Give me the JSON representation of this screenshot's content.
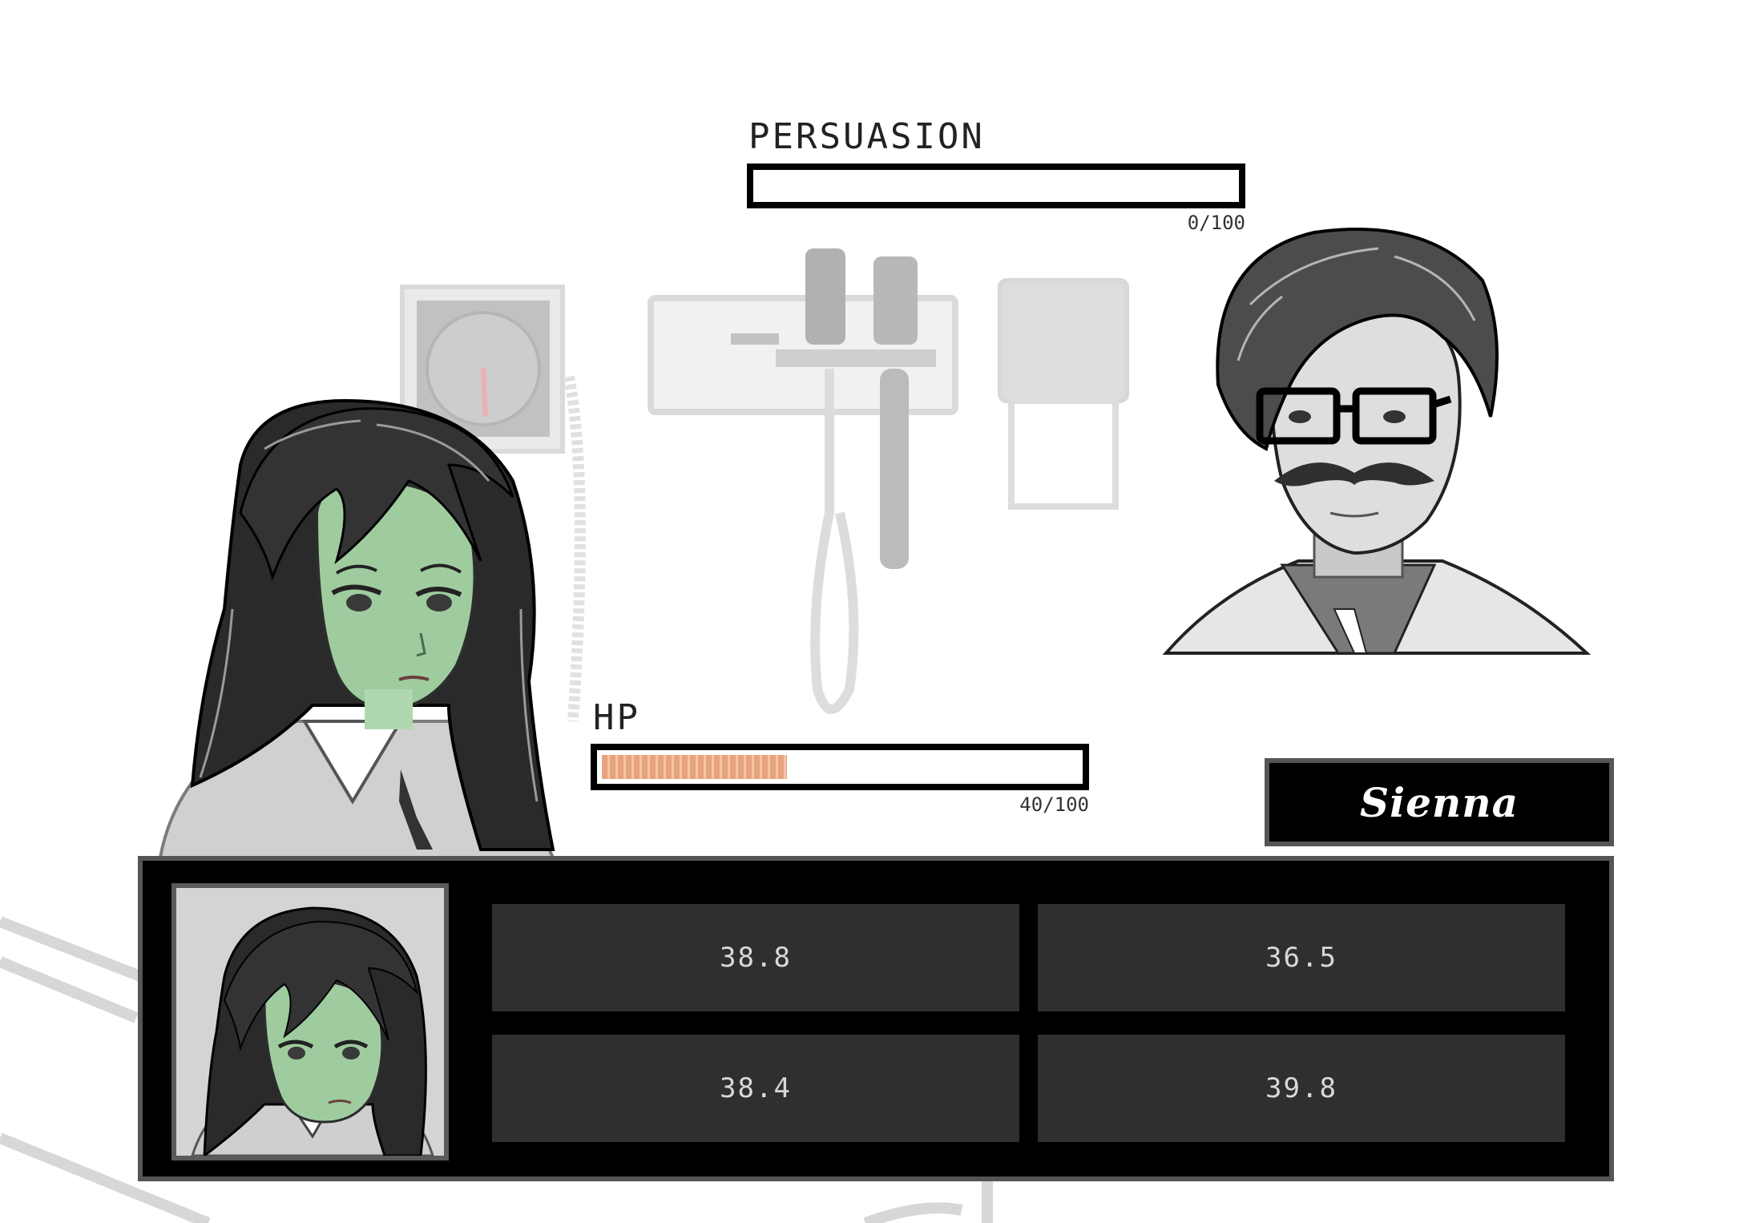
{
  "persuasion": {
    "label": "PERSUASION",
    "value_text": "0/100",
    "fraction": 0.0
  },
  "hp": {
    "label": "HP",
    "value_text": "40/100",
    "fraction": 0.4
  },
  "speaker": {
    "name": "Sienna"
  },
  "choices": [
    "38.8",
    "36.5",
    "38.4",
    "39.8"
  ],
  "colors": {
    "hp_fill": "#e8a27c",
    "skin_tint": "#9fcc9f",
    "panel": "#000000",
    "button": "#2f2f2f"
  }
}
